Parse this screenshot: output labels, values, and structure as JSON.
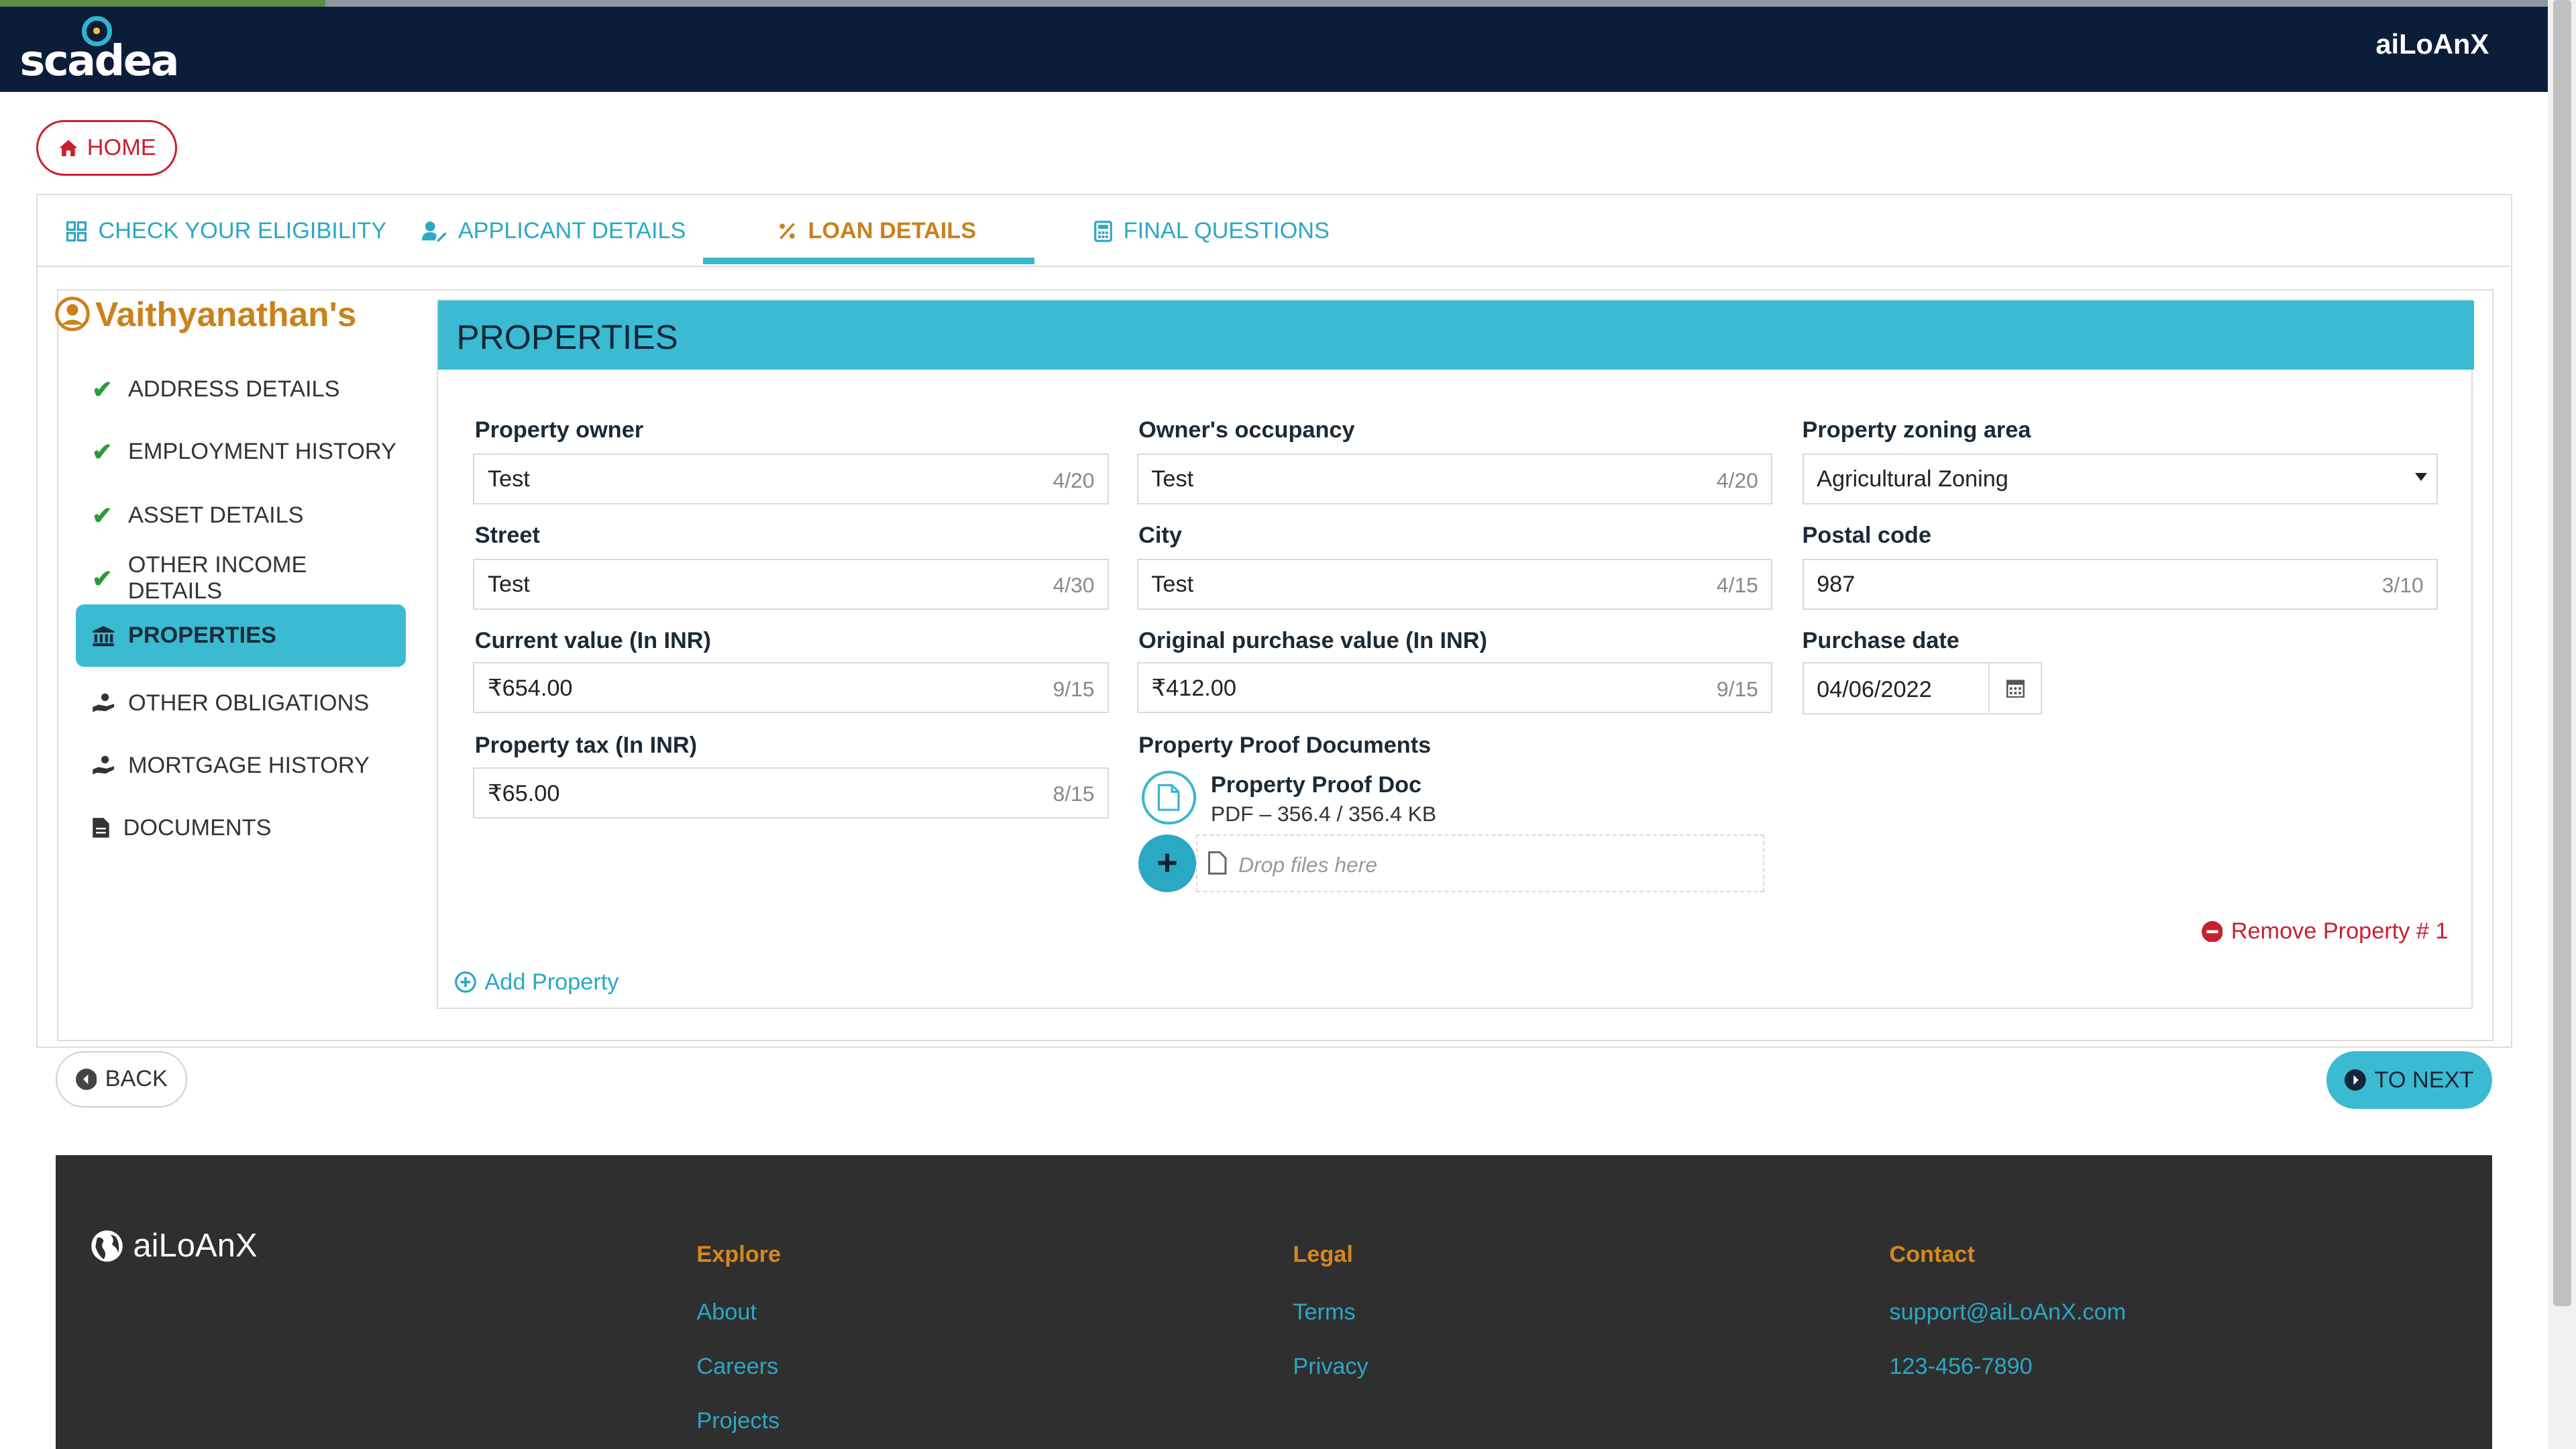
{
  "header": {
    "logo_text": "scadea",
    "app_name": "aiLoAnX"
  },
  "nav": {
    "home_label": "HOME"
  },
  "tabs": [
    {
      "label": "CHECK YOUR ELIGIBILITY",
      "icon": "grid-icon",
      "active": false
    },
    {
      "label": "APPLICANT DETAILS",
      "icon": "user-edit-icon",
      "active": false
    },
    {
      "label": "LOAN DETAILS",
      "icon": "percent-icon",
      "active": true
    },
    {
      "label": "FINAL QUESTIONS",
      "icon": "calculator-icon",
      "active": false
    }
  ],
  "sidebar": {
    "user_name": "Vaithyanathan's",
    "items": [
      {
        "label": "ADDRESS DETAILS",
        "icon": "check-icon",
        "completed": true
      },
      {
        "label": "EMPLOYMENT HISTORY",
        "icon": "check-icon",
        "completed": true
      },
      {
        "label": "ASSET DETAILS",
        "icon": "check-icon",
        "completed": true
      },
      {
        "label": "OTHER INCOME DETAILS",
        "icon": "check-icon",
        "completed": true
      },
      {
        "label": "PROPERTIES",
        "icon": "bank-icon",
        "active": true
      },
      {
        "label": "OTHER OBLIGATIONS",
        "icon": "hand-coin-icon"
      },
      {
        "label": "MORTGAGE HISTORY",
        "icon": "hand-coin-icon"
      },
      {
        "label": "DOCUMENTS",
        "icon": "file-icon"
      }
    ]
  },
  "form": {
    "title": "PROPERTIES",
    "property_owner": {
      "label": "Property owner",
      "value": "Test",
      "count": "4/20"
    },
    "owners_occupancy": {
      "label": "Owner's occupancy",
      "value": "Test",
      "count": "4/20"
    },
    "zoning_area": {
      "label": "Property zoning area",
      "value": "Agricultural Zoning"
    },
    "street": {
      "label": "Street",
      "value": "Test",
      "count": "4/30"
    },
    "city": {
      "label": "City",
      "value": "Test",
      "count": "4/15"
    },
    "postal_code": {
      "label": "Postal code",
      "value": "987",
      "count": "3/10"
    },
    "current_value": {
      "label": "Current value (In INR)",
      "value": "₹654.00",
      "count": "9/15"
    },
    "original_value": {
      "label": "Original purchase value (In INR)",
      "value": "₹412.00",
      "count": "9/15"
    },
    "purchase_date": {
      "label": "Purchase date",
      "value": "04/06/2022"
    },
    "property_tax": {
      "label": "Property tax (In INR)",
      "value": "₹65.00",
      "count": "8/15"
    },
    "documents": {
      "label": "Property Proof Documents",
      "file_name": "Property Proof Doc",
      "file_meta": "PDF – 356.4 / 356.4 KB",
      "drop_placeholder": "Drop files here"
    },
    "remove_label": "Remove Property # 1",
    "add_label": "Add Property"
  },
  "actions": {
    "back_label": "BACK",
    "next_label": "TO NEXT"
  },
  "footer": {
    "brand": "aiLoAnX",
    "explore": {
      "heading": "Explore",
      "links": [
        "About",
        "Careers",
        "Projects"
      ]
    },
    "legal": {
      "heading": "Legal",
      "links": [
        "Terms",
        "Privacy"
      ]
    },
    "contact": {
      "heading": "Contact",
      "email": "support@aiLoAnX.com",
      "phone": "123-456-7890"
    }
  },
  "colors": {
    "header_bg": "#0c1d3a",
    "accent_teal": "#3bbbd2",
    "accent_orange": "#c9821d",
    "danger_red": "#c8202f",
    "footer_bg": "#2f2f2f"
  }
}
